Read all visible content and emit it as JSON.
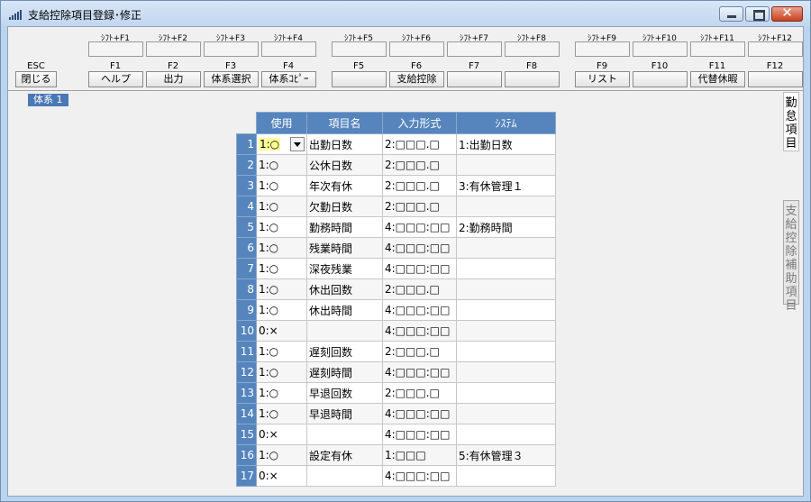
{
  "window": {
    "title": "支給控除項目登録･修正"
  },
  "fkeys": [
    {
      "shift": "",
      "key": "ESC",
      "label": "閉じる"
    },
    {
      "shift": "ｼﾌﾄ+F1",
      "key": "F1",
      "label": "ヘルプ"
    },
    {
      "shift": "ｼﾌﾄ+F2",
      "key": "F2",
      "label": "出力"
    },
    {
      "shift": "ｼﾌﾄ+F3",
      "key": "F3",
      "label": "体系選択"
    },
    {
      "shift": "ｼﾌﾄ+F4",
      "key": "F4",
      "label": "体系ｺﾋﾟｰ"
    },
    {
      "shift": "ｼﾌﾄ+F5",
      "key": "F5",
      "label": ""
    },
    {
      "shift": "ｼﾌﾄ+F6",
      "key": "F6",
      "label": "支給控除"
    },
    {
      "shift": "ｼﾌﾄ+F7",
      "key": "F7",
      "label": ""
    },
    {
      "shift": "ｼﾌﾄ+F8",
      "key": "F8",
      "label": ""
    },
    {
      "shift": "ｼﾌﾄ+F9",
      "key": "F9",
      "label": "リスト"
    },
    {
      "shift": "ｼﾌﾄ+F10",
      "key": "F10",
      "label": ""
    },
    {
      "shift": "ｼﾌﾄ+F11",
      "key": "F11",
      "label": "代替休暇"
    },
    {
      "shift": "ｼﾌﾄ+F12",
      "key": "F12",
      "label": ""
    }
  ],
  "system_tab": "体系 1",
  "grid": {
    "headers": [
      "使用",
      "項目名",
      "入力形式",
      "ｼｽﾃﾑ"
    ],
    "rows": [
      {
        "num": "1",
        "use": "1:○",
        "name": "出勤日数",
        "format": "2:□□□.□",
        "system": "1:出勤日数"
      },
      {
        "num": "2",
        "use": "1:○",
        "name": "公休日数",
        "format": "2:□□□.□",
        "system": ""
      },
      {
        "num": "3",
        "use": "1:○",
        "name": "年次有休",
        "format": "2:□□□.□",
        "system": "3:有休管理１"
      },
      {
        "num": "4",
        "use": "1:○",
        "name": "欠勤日数",
        "format": "2:□□□.□",
        "system": ""
      },
      {
        "num": "5",
        "use": "1:○",
        "name": "勤務時間",
        "format": "4:□□□:□□",
        "system": "2:勤務時間"
      },
      {
        "num": "6",
        "use": "1:○",
        "name": "残業時間",
        "format": "4:□□□:□□",
        "system": ""
      },
      {
        "num": "7",
        "use": "1:○",
        "name": "深夜残業",
        "format": "4:□□□:□□",
        "system": ""
      },
      {
        "num": "8",
        "use": "1:○",
        "name": "休出回数",
        "format": "2:□□□.□",
        "system": ""
      },
      {
        "num": "9",
        "use": "1:○",
        "name": "休出時間",
        "format": "4:□□□:□□",
        "system": ""
      },
      {
        "num": "10",
        "use": "0:×",
        "name": "",
        "format": "4:□□□:□□",
        "system": ""
      },
      {
        "num": "11",
        "use": "1:○",
        "name": "遅刻回数",
        "format": "2:□□□.□",
        "system": ""
      },
      {
        "num": "12",
        "use": "1:○",
        "name": "遅刻時間",
        "format": "4:□□□:□□",
        "system": ""
      },
      {
        "num": "13",
        "use": "1:○",
        "name": "早退回数",
        "format": "2:□□□.□",
        "system": ""
      },
      {
        "num": "14",
        "use": "1:○",
        "name": "早退時間",
        "format": "4:□□□:□□",
        "system": ""
      },
      {
        "num": "15",
        "use": "0:×",
        "name": "",
        "format": "4:□□□:□□",
        "system": ""
      },
      {
        "num": "16",
        "use": "1:○",
        "name": "設定有休",
        "format": "1:□□□",
        "system": "5:有休管理３"
      },
      {
        "num": "17",
        "use": "0:×",
        "name": "",
        "format": "4:□□□:□□",
        "system": ""
      }
    ]
  },
  "side_tabs": {
    "active": "勤怠項目",
    "inactive": "支給控除補助項目"
  },
  "colors": {
    "header_blue": "#5685bd",
    "selected_cell": "#ffff99",
    "close_button": "#c6401f"
  }
}
